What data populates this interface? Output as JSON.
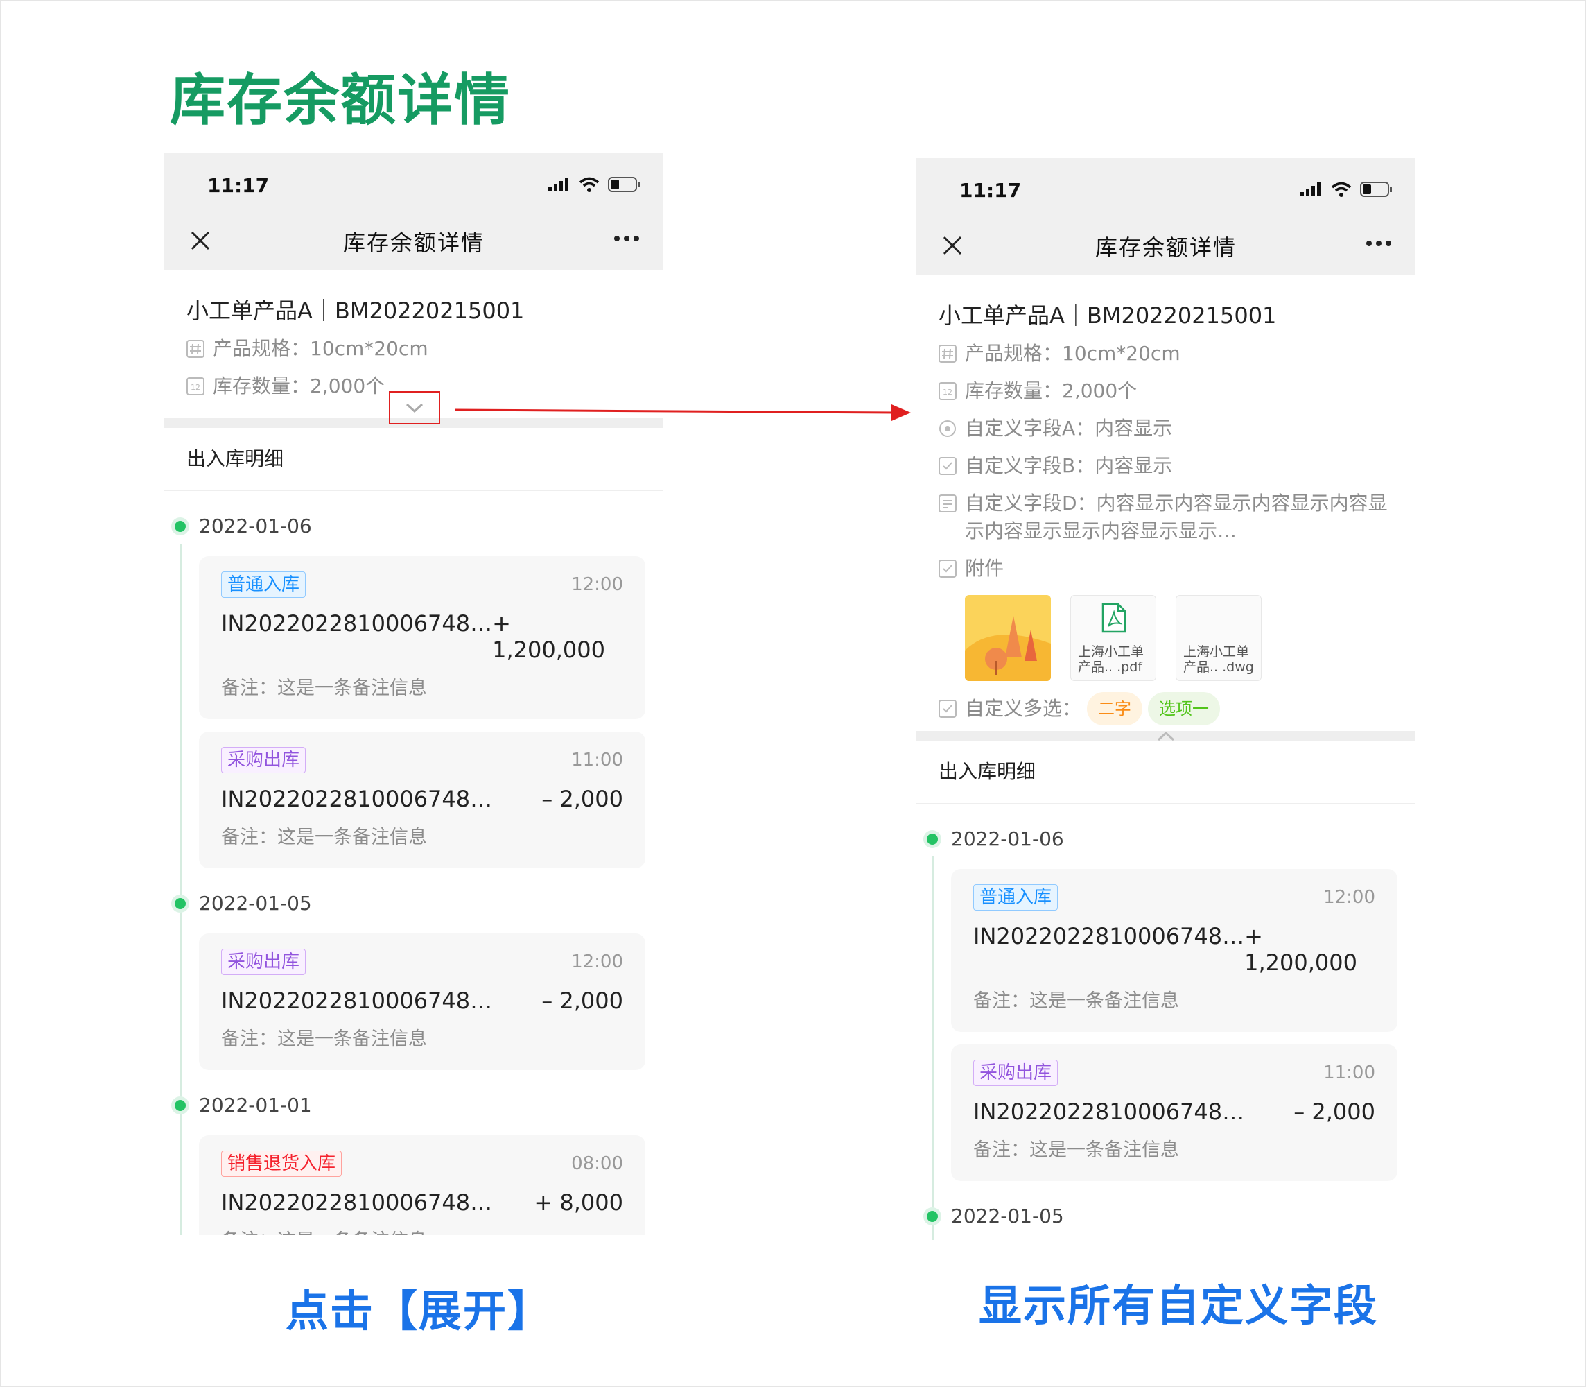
{
  "page_title": "库存余额详情",
  "left_caption": "点击【展开】",
  "right_caption": "显示所有自定义字段",
  "colors": {
    "brand_green": "#169b62",
    "caption_blue": "#1a73e8",
    "arrow_red": "#e02020"
  },
  "status_time": "11:17",
  "nav_title": "库存余额详情",
  "product_name": "小工单产品A｜BM20220215001",
  "fields": {
    "spec": "产品规格：10cm*20cm",
    "qty": "库存数量：2,000个",
    "custom_a": "自定义字段A：内容显示",
    "custom_b": "自定义字段B：内容显示",
    "custom_d": "自定义字段D：内容显示内容显示内容显示内容显示内容显示显示内容显示显示…",
    "attachment": "附件",
    "multi": "自定义多选："
  },
  "attachments": [
    {
      "type": "image"
    },
    {
      "type": "pdf",
      "name": "上海小工单产品.. .pdf"
    },
    {
      "type": "dwg",
      "name": "上海小工单产品.. .dwg"
    }
  ],
  "multi_options": [
    "二字",
    "选项一"
  ],
  "section_title": "出入库明细",
  "timeline": [
    {
      "date": "2022-01-06",
      "records": [
        {
          "tag": "普通入库",
          "tag_color": "blue",
          "time": "12:00",
          "code": "IN2022022810006748…",
          "amount": "+ 1,200,000",
          "note": "备注：这是一条备注信息"
        },
        {
          "tag": "采购出库",
          "tag_color": "purple",
          "time": "11:00",
          "code": "IN2022022810006748…",
          "amount": "– 2,000",
          "note": "备注：这是一条备注信息"
        }
      ]
    },
    {
      "date": "2022-01-05",
      "records": [
        {
          "tag": "采购出库",
          "tag_color": "purple",
          "time": "12:00",
          "code": "IN2022022810006748…",
          "amount": "– 2,000",
          "note": "备注：这是一条备注信息"
        }
      ]
    },
    {
      "date": "2022-01-01",
      "records": [
        {
          "tag": "销售退货入库",
          "tag_color": "red",
          "time": "08:00",
          "code": "IN2022022810006748…",
          "amount": "+ 8,000",
          "note": "备注：这是一条备注信息"
        }
      ]
    }
  ]
}
